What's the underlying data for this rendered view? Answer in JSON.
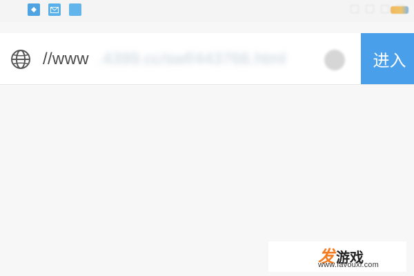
{
  "status_bar": {
    "notification_icons": [
      "app-icon",
      "mail-icon",
      "app-icon"
    ]
  },
  "address_bar": {
    "url_visible": "//www",
    "url_obscured": ".4399.cc/swf/443766.html",
    "enter_label": "进入",
    "icons": {
      "leading": "globe-icon",
      "clear": "clear-icon"
    }
  },
  "colors": {
    "accent": "#4a9fea",
    "watermark_orange": "#f47b20"
  },
  "watermark": {
    "logo_char_1": "发",
    "logo_rest": "游戏",
    "domain": "www.favouxi.com"
  }
}
